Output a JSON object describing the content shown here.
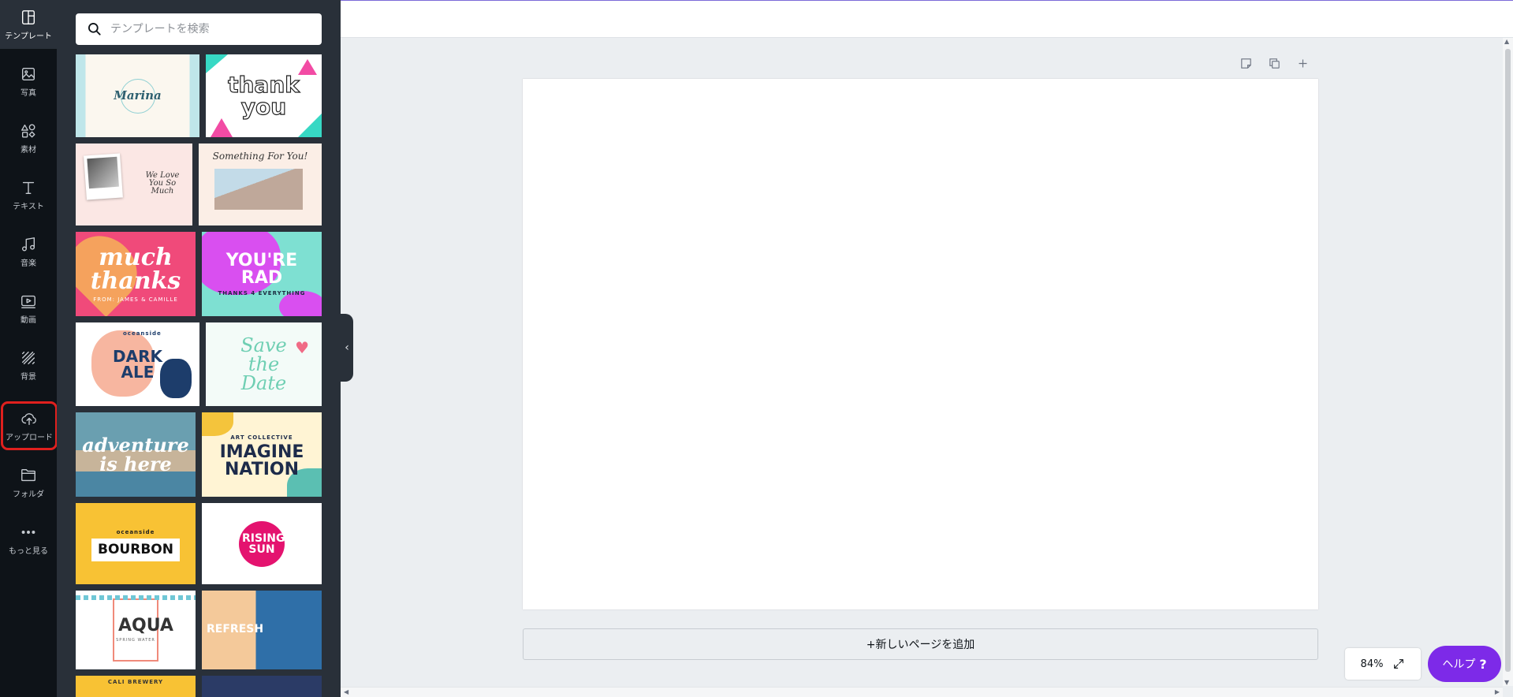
{
  "rail": {
    "templates": "テンプレート",
    "photos": "写真",
    "elements": "素材",
    "text": "テキスト",
    "music": "音楽",
    "videos": "動画",
    "background": "背景",
    "uploads": "アップロード",
    "folders": "フォルダ",
    "more": "もっと見る"
  },
  "search": {
    "placeholder": "テンプレートを検索"
  },
  "templates": [
    {
      "title": "Marina"
    },
    {
      "title": "thank you"
    },
    {
      "title": "We Love You So Much"
    },
    {
      "title": "Something For You!"
    },
    {
      "title": "much thanks",
      "subtitle": "FROM: JAMES & CAMILLE"
    },
    {
      "title": "YOU'RE RAD",
      "subtitle": "THANKS 4 EVERYTHING"
    },
    {
      "title": "DARK ALE",
      "subtitle": "oceanside"
    },
    {
      "title": "Save the Date"
    },
    {
      "title": "adventure is here"
    },
    {
      "title": "IMAGINE NATION",
      "subtitle": "ART COLLECTIVE"
    },
    {
      "title": "BOURBON",
      "subtitle": "oceanside"
    },
    {
      "title": "RISING SUN"
    },
    {
      "title": "AQUA",
      "subtitle": "SPRING WATER"
    },
    {
      "title": "REFRESH"
    },
    {
      "title": "CALI BREWERY"
    }
  ],
  "editor": {
    "add_page": "+新しいページを追加",
    "zoom": "84%",
    "help": "ヘルプ",
    "help_mark": "?"
  },
  "colors": {
    "accent": "#7d2ae8",
    "rail": "#0e1318",
    "panel": "#293039",
    "highlight": "#e0201e"
  }
}
